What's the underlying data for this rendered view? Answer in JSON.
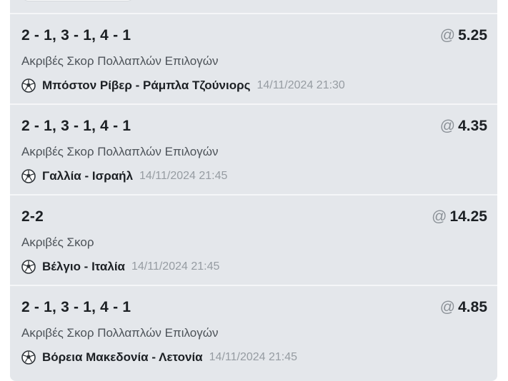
{
  "bets": [
    {
      "selection": "2 - 1, 3 - 1, 4 - 1",
      "odds_prefix": "@",
      "odds": "5.25",
      "market": "Ακριβές Σκορ Πολλαπλών Επιλογών",
      "event": "Μπόστον Ρίβερ - Ράμπλα Τζούνιορς",
      "datetime": "14/11/2024 21:30",
      "sport_icon": "soccer-ball-icon"
    },
    {
      "selection": "2 - 1, 3 - 1, 4 - 1",
      "odds_prefix": "@",
      "odds": "4.35",
      "market": "Ακριβές Σκορ Πολλαπλών Επιλογών",
      "event": "Γαλλία - Ισραήλ",
      "datetime": "14/11/2024 21:45",
      "sport_icon": "soccer-ball-icon"
    },
    {
      "selection": "2-2",
      "odds_prefix": "@",
      "odds": "14.25",
      "market": "Ακριβές Σκορ",
      "event": "Βέλγιο - Ιταλία",
      "datetime": "14/11/2024 21:45",
      "sport_icon": "soccer-ball-icon"
    },
    {
      "selection": "2 - 1, 3 - 1, 4 - 1",
      "odds_prefix": "@",
      "odds": "4.85",
      "market": "Ακριβές Σκορ Πολλαπλών Επιλογών",
      "event": "Βόρεια Μακεδονία - Λετονία",
      "datetime": "14/11/2024 21:45",
      "sport_icon": "soccer-ball-icon"
    }
  ]
}
